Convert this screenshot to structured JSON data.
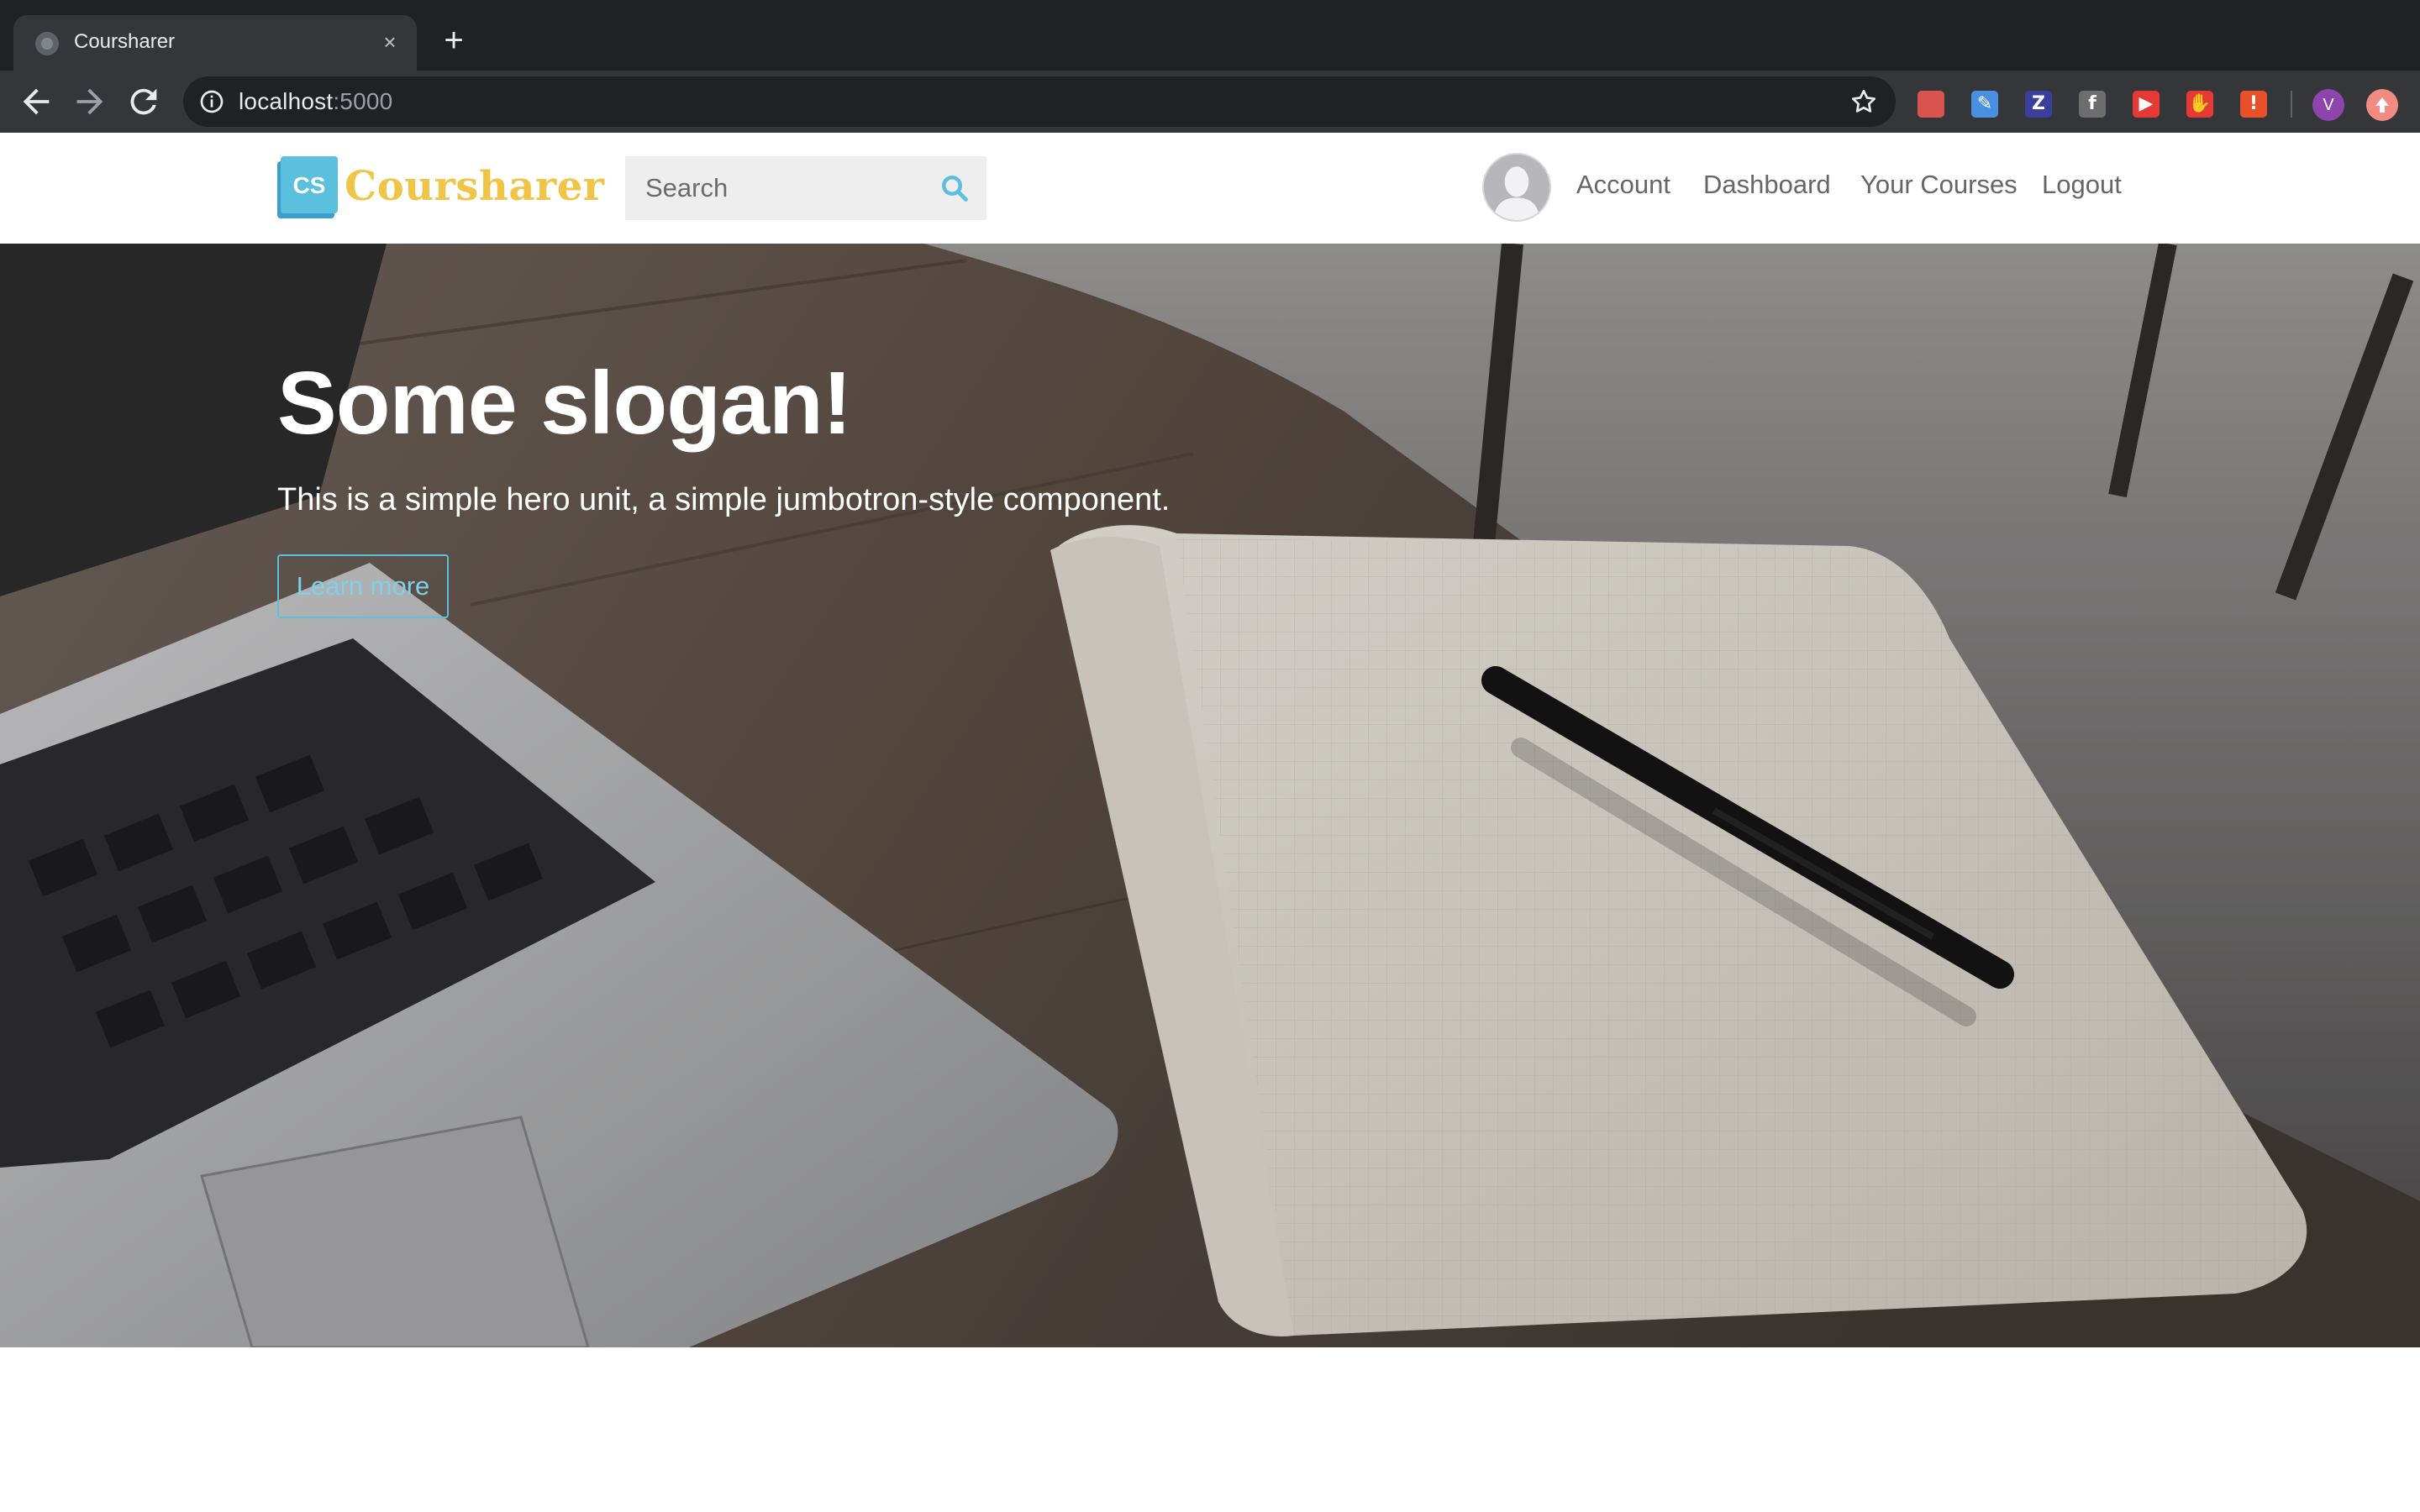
{
  "browser": {
    "tab_title": "Coursharer",
    "close_glyph": "×",
    "new_tab_glyph": "+",
    "url_host": "localhost",
    "url_port": ":5000",
    "profile_initial": "V",
    "extensions": [
      {
        "name": "red-book-extension-icon",
        "glyph": "",
        "color": "#d9534f"
      },
      {
        "name": "highlighter-extension-icon",
        "glyph": "✎",
        "color": "#4a90e2"
      },
      {
        "name": "z-extension-icon",
        "glyph": "Z",
        "color": "#3b3f9c"
      },
      {
        "name": "facebook-extension-icon",
        "glyph": "f",
        "color": "#6d6d6d"
      },
      {
        "name": "youtube-extension-icon",
        "glyph": "▶",
        "color": "#e53935"
      },
      {
        "name": "hand-block-extension-icon",
        "glyph": "✋",
        "color": "#e53935"
      },
      {
        "name": "alert-extension-icon",
        "glyph": "!",
        "color": "#e8502a"
      }
    ]
  },
  "site": {
    "logo_badge": "CS",
    "logo_text": "Coursharer",
    "search_placeholder": "Search",
    "nav": {
      "account": "Account",
      "dashboard": "Dashboard",
      "your_courses": "Your Courses",
      "logout": "Logout"
    },
    "colors": {
      "brand_blue": "#5bc0de",
      "brand_yellow": "#f0c446"
    }
  },
  "hero": {
    "title": "Some slogan!",
    "subtitle": "This is a simple hero unit, a simple jumbotron-style component.",
    "button_label": "Learn more"
  }
}
